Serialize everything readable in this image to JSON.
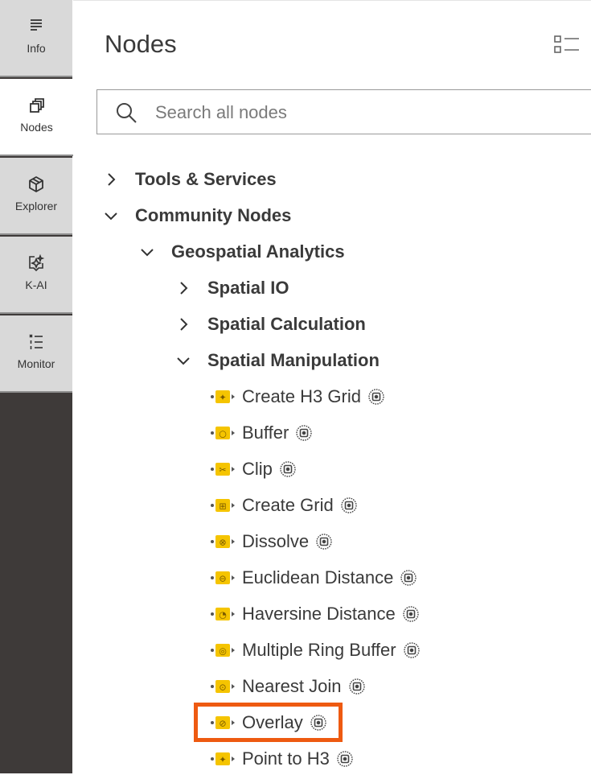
{
  "rail": {
    "tabs": [
      {
        "label": "Info",
        "icon": "info-lines-icon",
        "active": false
      },
      {
        "label": "Nodes",
        "icon": "nodes-icon",
        "active": true
      },
      {
        "label": "Explorer",
        "icon": "cube-icon",
        "active": false
      },
      {
        "label": "K-AI",
        "icon": "sparkle-chat-icon",
        "active": false
      },
      {
        "label": "Monitor",
        "icon": "list-check-icon",
        "active": false
      }
    ]
  },
  "panel": {
    "title": "Nodes",
    "search_placeholder": "Search all nodes"
  },
  "tree": {
    "categories": [
      {
        "label": "Tools & Services",
        "expanded": false
      },
      {
        "label": "Community Nodes",
        "expanded": true
      },
      {
        "label": "Geospatial Analytics",
        "expanded": true
      },
      {
        "label": "Spatial IO",
        "expanded": false
      },
      {
        "label": "Spatial Calculation",
        "expanded": false
      },
      {
        "label": "Spatial Manipulation",
        "expanded": true
      }
    ],
    "nodes": [
      {
        "label": "Create H3 Grid",
        "glyph": "✦"
      },
      {
        "label": "Buffer",
        "glyph": "○"
      },
      {
        "label": "Clip",
        "glyph": "✂"
      },
      {
        "label": "Create Grid",
        "glyph": "⊞"
      },
      {
        "label": "Dissolve",
        "glyph": "⊗"
      },
      {
        "label": "Euclidean Distance",
        "glyph": "⊖"
      },
      {
        "label": "Haversine Distance",
        "glyph": "◔"
      },
      {
        "label": "Multiple Ring Buffer",
        "glyph": "◎"
      },
      {
        "label": "Nearest Join",
        "glyph": "⊙"
      },
      {
        "label": "Overlay",
        "glyph": "⊘"
      },
      {
        "label": "Point to H3",
        "glyph": "✦"
      }
    ],
    "highlighted_node": "Overlay"
  },
  "colors": {
    "rail_bg": "#3e3a39",
    "tab_bg": "#d9d9d9",
    "node_icon": "#f5c400",
    "highlight": "#ee5a11"
  }
}
